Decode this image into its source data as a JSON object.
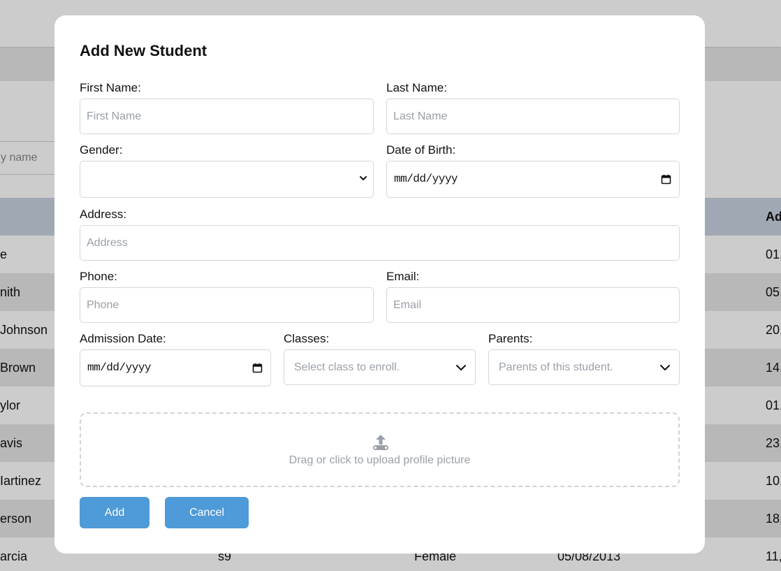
{
  "background": {
    "search_placeholder": "y name",
    "table_header_last": "Ad",
    "rows": [
      {
        "name": "e",
        "id": "",
        "gender": "",
        "dob": "",
        "admission": "01,"
      },
      {
        "name": "nith",
        "id": "",
        "gender": "",
        "dob": "",
        "admission": "05,"
      },
      {
        "name": " Johnson",
        "id": "",
        "gender": "",
        "dob": "",
        "admission": "20,"
      },
      {
        "name": "Brown",
        "id": "",
        "gender": "",
        "dob": "",
        "admission": "14,"
      },
      {
        "name": "ylor",
        "id": "",
        "gender": "",
        "dob": "",
        "admission": "01,"
      },
      {
        "name": "avis",
        "id": "",
        "gender": "",
        "dob": "",
        "admission": "23,"
      },
      {
        "name": "Iartinez",
        "id": "",
        "gender": "",
        "dob": "",
        "admission": "10,"
      },
      {
        "name": "erson",
        "id": "",
        "gender": "",
        "dob": "",
        "admission": "18,"
      },
      {
        "name": "arcia",
        "id": "s9",
        "gender": "Female",
        "dob": "05/08/2013",
        "admission": "11,"
      }
    ]
  },
  "modal": {
    "title": "Add New Student",
    "first_name": {
      "label": "First Name:",
      "placeholder": "First Name",
      "value": ""
    },
    "last_name": {
      "label": "Last Name:",
      "placeholder": "Last Name",
      "value": ""
    },
    "gender": {
      "label": "Gender:",
      "value": ""
    },
    "dob": {
      "label": "Date of Birth:",
      "value": "mm/dd/yyyy"
    },
    "address": {
      "label": "Address:",
      "placeholder": "Address",
      "value": ""
    },
    "phone": {
      "label": "Phone:",
      "placeholder": "Phone",
      "value": ""
    },
    "email": {
      "label": "Email:",
      "placeholder": "Email",
      "value": ""
    },
    "admission_date": {
      "label": "Admission Date:",
      "value": "mm/dd/yyyy"
    },
    "classes": {
      "label": "Classes:",
      "placeholder": "Select class to enroll."
    },
    "parents": {
      "label": "Parents:",
      "placeholder": "Parents of this student."
    },
    "upload": {
      "text": "Drag or click to upload profile picture",
      "icon": "upload-icon"
    },
    "buttons": {
      "add": "Add",
      "cancel": "Cancel"
    }
  },
  "colors": {
    "primary_button": "#4f9ad8",
    "table_header": "#c9d2e0",
    "placeholder": "#9aa0a8"
  }
}
